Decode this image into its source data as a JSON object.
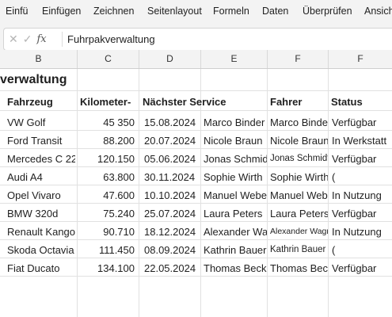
{
  "ribbon": {
    "tabs": [
      "Einfü",
      "Einfügen",
      "Zeichnen",
      "Seitenlayout",
      "Formeln",
      "Daten",
      "Überprüfen",
      "Ansicht"
    ]
  },
  "formula_bar": {
    "cancel_icon": "close-icon",
    "enter_icon": "check-icon",
    "fx_label": "fx",
    "content": "Fuhrpakverwaltung"
  },
  "columns": [
    "B",
    "C",
    "D",
    "E",
    "F",
    "F"
  ],
  "sheet": {
    "title": "verwaltung",
    "headers": [
      "Fahrzeug",
      "Kilometer-",
      "Nächster Service",
      "Fahrer",
      "Status"
    ],
    "rows": [
      {
        "fahrzeug": "VW Golf",
        "km": "45 350",
        "service": "15.08.2024",
        "e": "Marco Binder",
        "fahrer": "Marco Binder",
        "status": "Verfügbar"
      },
      {
        "fahrzeug": "Ford Transit",
        "km": "88.200",
        "service": "20.07.2024",
        "e": "Nicole Braun",
        "fahrer": "Nicole Braun",
        "status": "In Werkstatt"
      },
      {
        "fahrzeug": "Mercedes C 220",
        "km": "120.150",
        "service": "05.06.2024",
        "e": "Jonas Schmidt",
        "fahrer": "Jonas Schmidt",
        "status": "Verfügbar"
      },
      {
        "fahrzeug": "Audi A4",
        "km": "63.800",
        "service": "30.11.2024",
        "e": "Sophie Wirth",
        "fahrer": "Sophie Wirth",
        "status": "("
      },
      {
        "fahrzeug": "Opel Vivaro",
        "km": "47.600",
        "service": "10.10.2024",
        "e": "Manuel Weber",
        "fahrer": "Manuel Weber",
        "status": "In Nutzung"
      },
      {
        "fahrzeug": "BMW 320d",
        "km": "75.240",
        "service": "25.07.2024",
        "e": "Laura Peters",
        "fahrer": "Laura Peters",
        "status": "Verfügbar"
      },
      {
        "fahrzeug": "Renault Kangoo",
        "km": "90.710",
        "service": "18.12.2024",
        "e": "Alexander Wag",
        "fahrer": "Alexander Wagn.",
        "status": "In Nutzung"
      },
      {
        "fahrzeug": "Skoda Octavia",
        "km": "111.450",
        "service": "08.09.2024",
        "e": "Kathrin Bauer",
        "fahrer": "Kathrin Bauer",
        "status": "("
      },
      {
        "fahrzeug": "Fiat Ducato",
        "km": "134.100",
        "service": "22.05.2024",
        "e": "Thomas Beck",
        "fahrer": "Thomas Beck",
        "status": "Verfügbar"
      }
    ]
  }
}
